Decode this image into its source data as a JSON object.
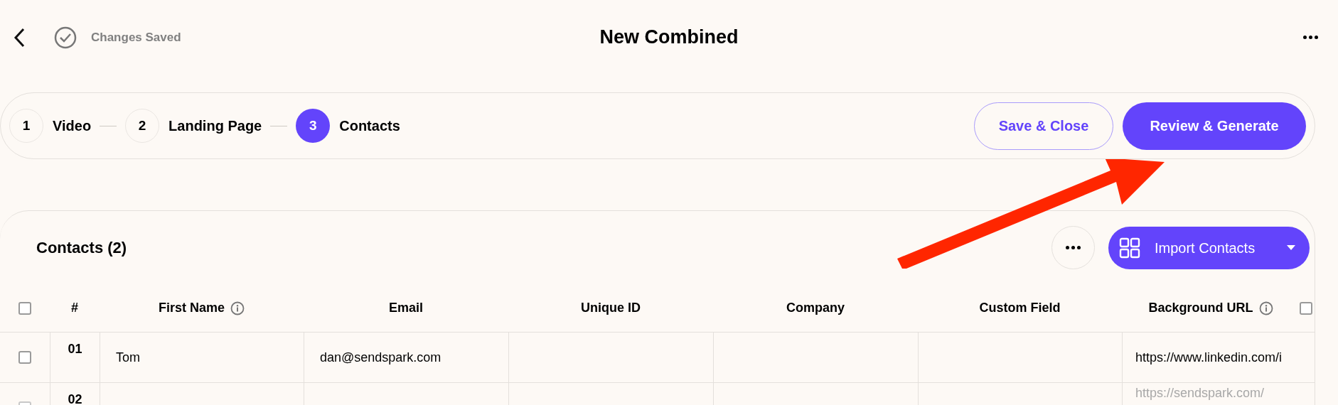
{
  "header": {
    "status": "Changes Saved",
    "title": "New Combined"
  },
  "steps": [
    {
      "number": "1",
      "label": "Video",
      "selected": false
    },
    {
      "number": "2",
      "label": "Landing Page",
      "selected": false
    },
    {
      "number": "3",
      "label": "Contacts",
      "selected": true
    }
  ],
  "actions": [
    {
      "label": "Save & Close",
      "kind": "outline"
    },
    {
      "label": "Review & Generate",
      "kind": "primary"
    }
  ],
  "contacts": {
    "title": "Contacts (2)",
    "import_button": "Import Contacts",
    "select_all_checked": false,
    "column_toggle_checked": false,
    "columns": [
      {
        "label": "#",
        "info": false
      },
      {
        "label": "First Name",
        "info": true
      },
      {
        "label": "Email",
        "info": false
      },
      {
        "label": "Unique ID",
        "info": false
      },
      {
        "label": "Company",
        "info": false
      },
      {
        "label": "Custom Field",
        "info": false
      },
      {
        "label": "Background URL",
        "info": true
      }
    ],
    "rows": [
      {
        "number": "01",
        "checked": false,
        "first_name": "Tom",
        "email": "dan@sendspark.com",
        "background_url": "https://www.linkedin.com/i"
      },
      {
        "number": "02",
        "checked": false,
        "background_url_placeholder": "https://sendspark.com/"
      }
    ]
  }
}
